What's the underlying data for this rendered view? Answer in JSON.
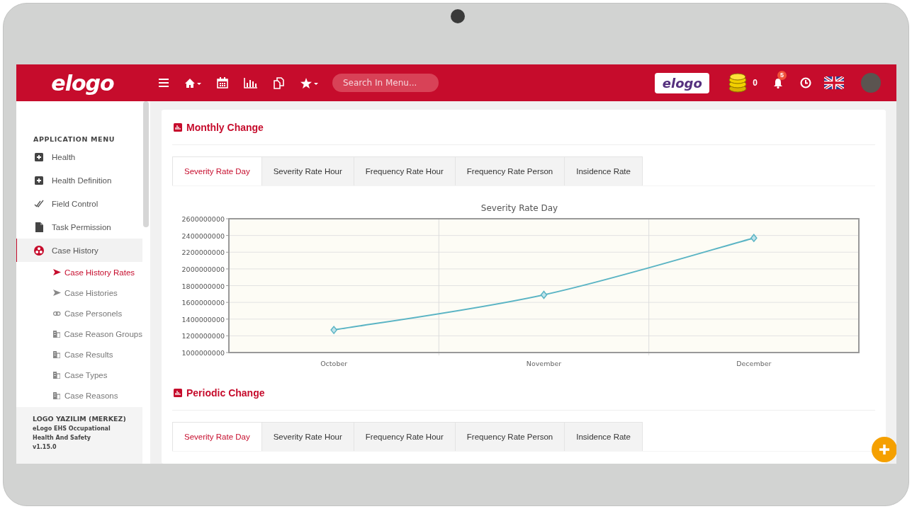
{
  "header": {
    "logo": "elogo",
    "search": {
      "placeholder": "Search In Menu..."
    },
    "brand_badge": "elogo",
    "coins": "0",
    "notifications": {
      "count": "5"
    }
  },
  "sidebar": {
    "heading": "APPLICATION MENU",
    "items": [
      {
        "label": "Health",
        "selected": false
      },
      {
        "label": "Health Definition",
        "selected": false
      },
      {
        "label": "Field Control",
        "selected": false
      },
      {
        "label": "Task Permission",
        "selected": false
      },
      {
        "label": "Case History",
        "selected": true,
        "children": [
          {
            "label": "Case History Rates",
            "selected": true
          },
          {
            "label": "Case Histories",
            "selected": false
          },
          {
            "label": "Case Personels",
            "selected": false
          },
          {
            "label": "Case Reason Groups",
            "selected": false
          },
          {
            "label": "Case Results",
            "selected": false
          },
          {
            "label": "Case Types",
            "selected": false
          },
          {
            "label": "Case Reasons",
            "selected": false
          }
        ]
      }
    ],
    "footer": {
      "company": "LOGO YAZILIM (MERKEZ)",
      "product": "eLogo EHS Occupational Health And Safety",
      "version": "v1.15.0"
    }
  },
  "sections": [
    {
      "title": "Monthly Change",
      "tabs": [
        {
          "label": "Severity Rate Day",
          "selected": true
        },
        {
          "label": "Severity Rate Hour",
          "selected": false
        },
        {
          "label": "Frequency Rate Hour",
          "selected": false
        },
        {
          "label": "Frequency Rate Person",
          "selected": false
        },
        {
          "label": "Insidence Rate",
          "selected": false
        }
      ],
      "chart_data": {
        "type": "line",
        "title": "Severity Rate Day",
        "categories": [
          "October",
          "November",
          "December"
        ],
        "grid": true,
        "series": [
          {
            "color": "#5ab4c4",
            "marker": "diamond",
            "values": [
              1270000000,
              1690000000,
              2370000000
            ]
          }
        ],
        "ylim": [
          1000000000,
          2600000000
        ],
        "yticks": [
          1000000000,
          1200000000,
          1400000000,
          1600000000,
          1800000000,
          2000000000,
          2200000000,
          2400000000,
          2600000000
        ]
      }
    },
    {
      "title": "Periodic Change",
      "tabs": [
        {
          "label": "Severity Rate Day",
          "selected": true
        },
        {
          "label": "Severity Rate Hour",
          "selected": false
        },
        {
          "label": "Frequency Rate Hour",
          "selected": false
        },
        {
          "label": "Frequency Rate Person",
          "selected": false
        },
        {
          "label": "Insidence Rate",
          "selected": false
        }
      ]
    }
  ]
}
